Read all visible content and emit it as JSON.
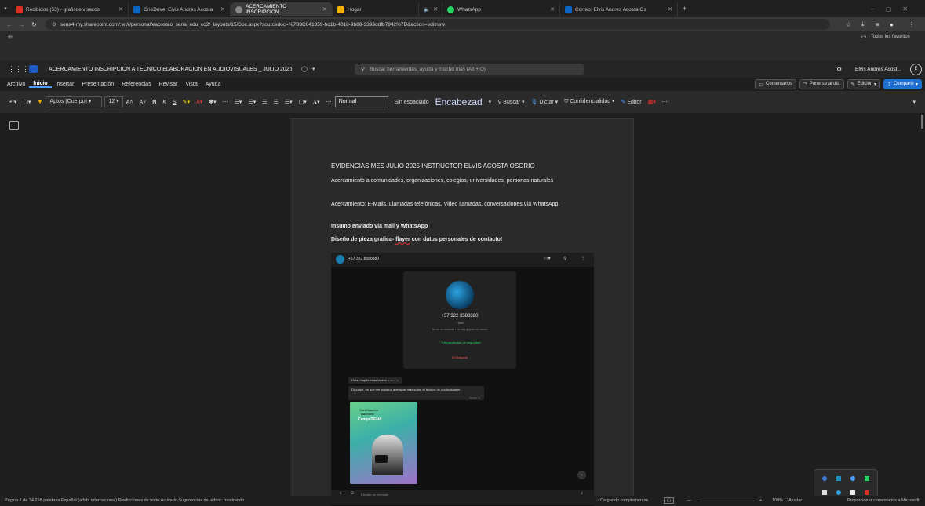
{
  "browser": {
    "tabs": [
      {
        "label": "Recibidos (53) - graficoelvisacos",
        "color": "#d93025"
      },
      {
        "label": "OneDrive: Elvis Andres Acosta",
        "color": "#0a66c2"
      },
      {
        "label": "ACERCAMIENTO INSCRIPCION",
        "color": "#888888",
        "active": true
      },
      {
        "label": "Hogar",
        "color": "#f2b400"
      },
      {
        "label": "",
        "color": "#444444"
      },
      {
        "label": "WhatsApp",
        "color": "#25d366"
      },
      {
        "label": "Correo: Elvis Andres Acosta Os",
        "color": "#0a66c2"
      }
    ],
    "url": "sena4-my.sharepoint.com/:w:/r/personal/eacostao_sena_edu_co2/_layouts/15/Doc.aspx?sourcedoc=%7B3C641359-bd1b-4018-9b88-3393ddfb7942%7D&action=editnew",
    "favorites": "Todos los favoritos"
  },
  "word": {
    "doc_title": "ACERCAMIENTO INSCRIPCION A TECNICO ELABORACION EN AUDIOVISUALES _ JULIO 2025",
    "search_placeholder": "Buscar herramientas, ayuda y mucho más (Alt + Q)",
    "user_name": "Elvis Andres Acost...",
    "user_initial": "E",
    "menu": [
      "Archivo",
      "Inicio",
      "Insertar",
      "Presentación",
      "Referencias",
      "Revisar",
      "Vista",
      "Ayuda"
    ],
    "ribbon_buttons": {
      "comments": "Comentarios",
      "catchup": "Ponerse al día",
      "editing": "Edición",
      "share": "Compartir"
    },
    "toolbar": {
      "font": "Aptos (Cuerpo)",
      "size": "12",
      "style_normal": "Normal",
      "style_nospacing": "Sin espaciado",
      "style_heading": "Encabezad",
      "search": "Buscar",
      "dictate": "Dictar",
      "confidentiality": "Confidencialidad",
      "editor": "Editor"
    }
  },
  "document": {
    "heading": "EVIDENCIAS MES JULIO 2025 INSTRUCTOR ELVIS ACOSTA OSORIO",
    "para1": "Acercamiento a comunidades, organizaciones, colegios, universidades, personas naturales",
    "para2": "Acercamiento: E-Mails, Llamadas telefónicas, Video llamadas, conversaciones vía WhatsApp.",
    "para3": "Insumo enviado vía mail y WhatsApp",
    "para4_prefix": "Diseño de pieza grafica- ",
    "para4_word": "flayer",
    "para4_suffix": " con datos personales de contacto!"
  },
  "whatsapp": {
    "phone_header": "+57 322 8588380",
    "profile_phone": "+57 322 8588380",
    "profile_name": "~Tomi",
    "not_contact": "No es un contacto • No hay grupos en común",
    "security": "Herramientas de seguridad",
    "block": "Bloquear",
    "msg1": "Hola, muy buenas tardes",
    "msg1_time": "11:19 p. m.",
    "msg2": "Disculpe, es que me gustaría averiguar más sobre el técnico de audiovisuales",
    "msg2_time": "11:19 p. m.",
    "compose_placeholder": "Escribe un mensaje",
    "flyer_title1": "Certificación",
    "flyer_title2": "Nacional",
    "flyer_brand": "CampeSENA"
  },
  "statusbar": {
    "left": "Página 1 de 34   258 palabras   Español (alfab. internacional)   Predicciones de texto:Activado   Sugerencias del editor: mostrando",
    "loading": "Cargando complementos",
    "zoom": "100%",
    "fit": "Ajustar",
    "feedback": "Proporcionar comentarios a Microsoft"
  }
}
